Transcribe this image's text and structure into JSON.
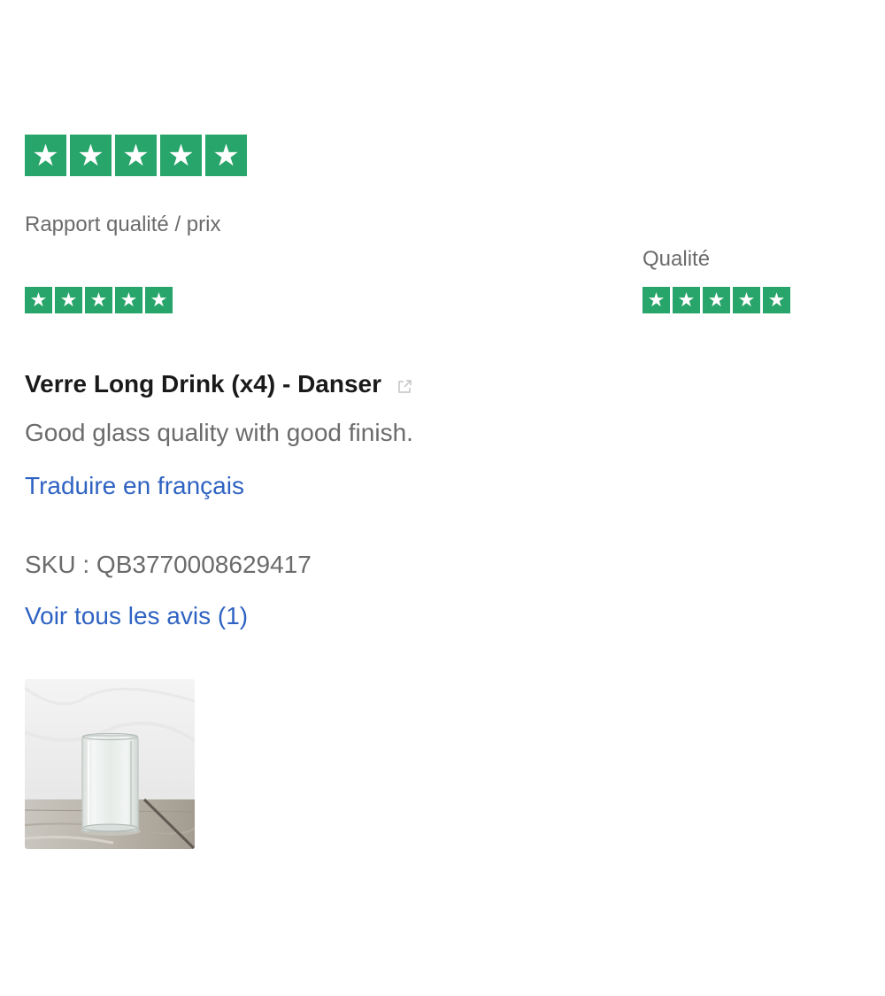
{
  "rating": {
    "overall_stars": 5,
    "star_color": "#28a56a",
    "star_glyph": "★"
  },
  "sub_ratings": {
    "value_label": "Rapport qualité / prix",
    "value_stars": 5,
    "quality_label": "Qualité",
    "quality_stars": 5
  },
  "product": {
    "title": "Verre Long Drink (x4) - Danser",
    "title_icon": "external-link-icon"
  },
  "review": {
    "text": "Good glass quality with good finish.",
    "translate_link": "Traduire en français"
  },
  "sku": {
    "text": "SKU : QB3770008629417"
  },
  "all_reviews_link": "Voir tous les avis (1)",
  "photo": {
    "alt": "review-photo-glass"
  },
  "colors": {
    "link": "#2f63c2",
    "muted_text": "#6b6b6b",
    "title_text": "#1a1a1a"
  }
}
